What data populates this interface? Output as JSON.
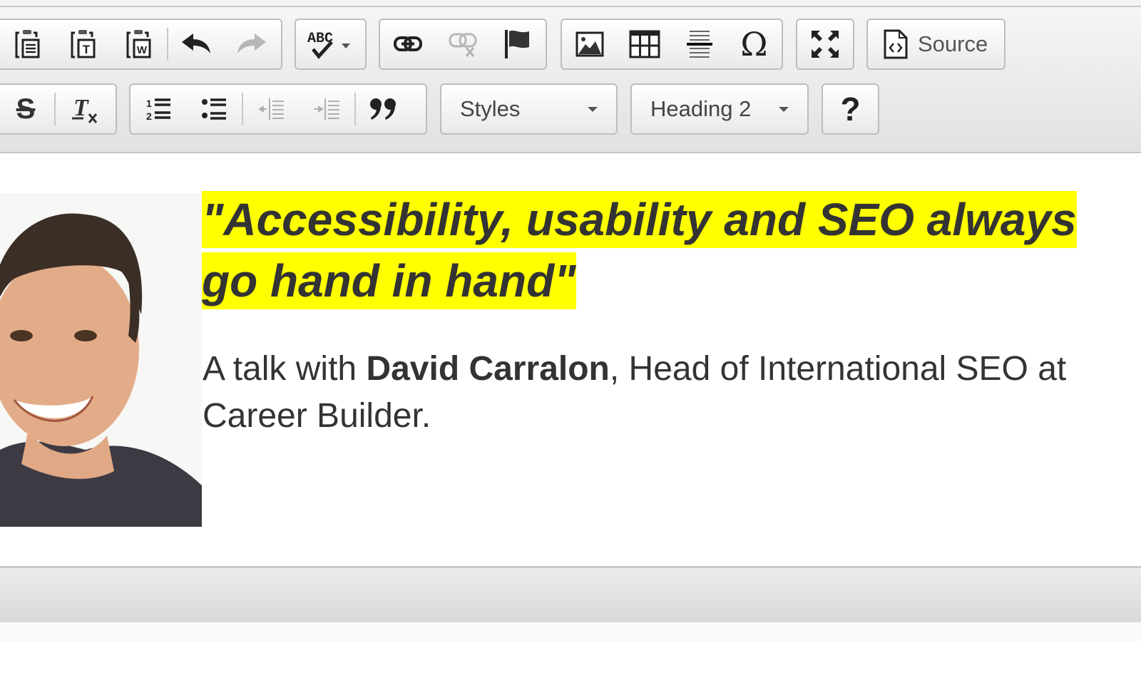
{
  "toolbar": {
    "row1": {
      "clipboard": [
        {
          "name": "paste-icon",
          "label": "Paste",
          "enabled": true
        },
        {
          "name": "paste-text-icon",
          "label": "Paste as plain text",
          "enabled": true
        },
        {
          "name": "paste-word-icon",
          "label": "Paste from Word",
          "enabled": true
        },
        {
          "name": "undo-icon",
          "label": "Undo",
          "enabled": true
        },
        {
          "name": "redo-icon",
          "label": "Redo",
          "enabled": false
        }
      ],
      "spellcheck": {
        "name": "spellcheck-icon",
        "label": "Spell Check As You Type",
        "enabled": true
      },
      "links": [
        {
          "name": "link-icon",
          "label": "Link",
          "enabled": true
        },
        {
          "name": "unlink-icon",
          "label": "Unlink",
          "enabled": false
        },
        {
          "name": "anchor-icon",
          "label": "Anchor",
          "enabled": true
        }
      ],
      "insert": [
        {
          "name": "image-icon",
          "label": "Image",
          "enabled": true
        },
        {
          "name": "table-icon",
          "label": "Table",
          "enabled": true
        },
        {
          "name": "horizontal-line-icon",
          "label": "Insert Horizontal Line",
          "enabled": true
        },
        {
          "name": "special-char-icon",
          "label": "Insert Special Character",
          "glyph": "Ω",
          "enabled": true
        }
      ],
      "maximize": {
        "name": "maximize-icon",
        "label": "Maximize",
        "enabled": true
      },
      "source": {
        "label": "Source"
      }
    },
    "row2": {
      "basic": [
        {
          "name": "strikethrough-icon",
          "label": "Strikethrough",
          "glyph": "S",
          "enabled": true
        },
        {
          "name": "remove-format-icon",
          "label": "Remove Format",
          "glyph": "T",
          "enabled": true
        }
      ],
      "lists": [
        {
          "name": "numbered-list-icon",
          "label": "Insert/Remove Numbered List",
          "enabled": true
        },
        {
          "name": "bulleted-list-icon",
          "label": "Insert/Remove Bulleted List",
          "enabled": true
        },
        {
          "name": "outdent-icon",
          "label": "Decrease Indent",
          "enabled": false
        },
        {
          "name": "indent-icon",
          "label": "Increase Indent",
          "enabled": false
        },
        {
          "name": "blockquote-icon",
          "label": "Block Quote",
          "glyph": "99",
          "enabled": true
        }
      ],
      "styles": {
        "value": "Styles"
      },
      "format": {
        "value": "Heading 2"
      },
      "help": {
        "glyph": "?",
        "label": "About CKEditor"
      }
    }
  },
  "content": {
    "photo_alt": "Portrait of David Carralon",
    "heading": "\"Accessibility, usability and SEO always go hand in hand\"",
    "heading_line1": "\"Accessibility, usability and SEO always",
    "heading_line2": "go hand in hand\"",
    "highlight_color": "#ffff00",
    "lede_prefix": "A talk with ",
    "lede_name": "David Carralon",
    "lede_suffix_line1": ", Head of International SEO at",
    "lede_line2": "Career Builder."
  }
}
